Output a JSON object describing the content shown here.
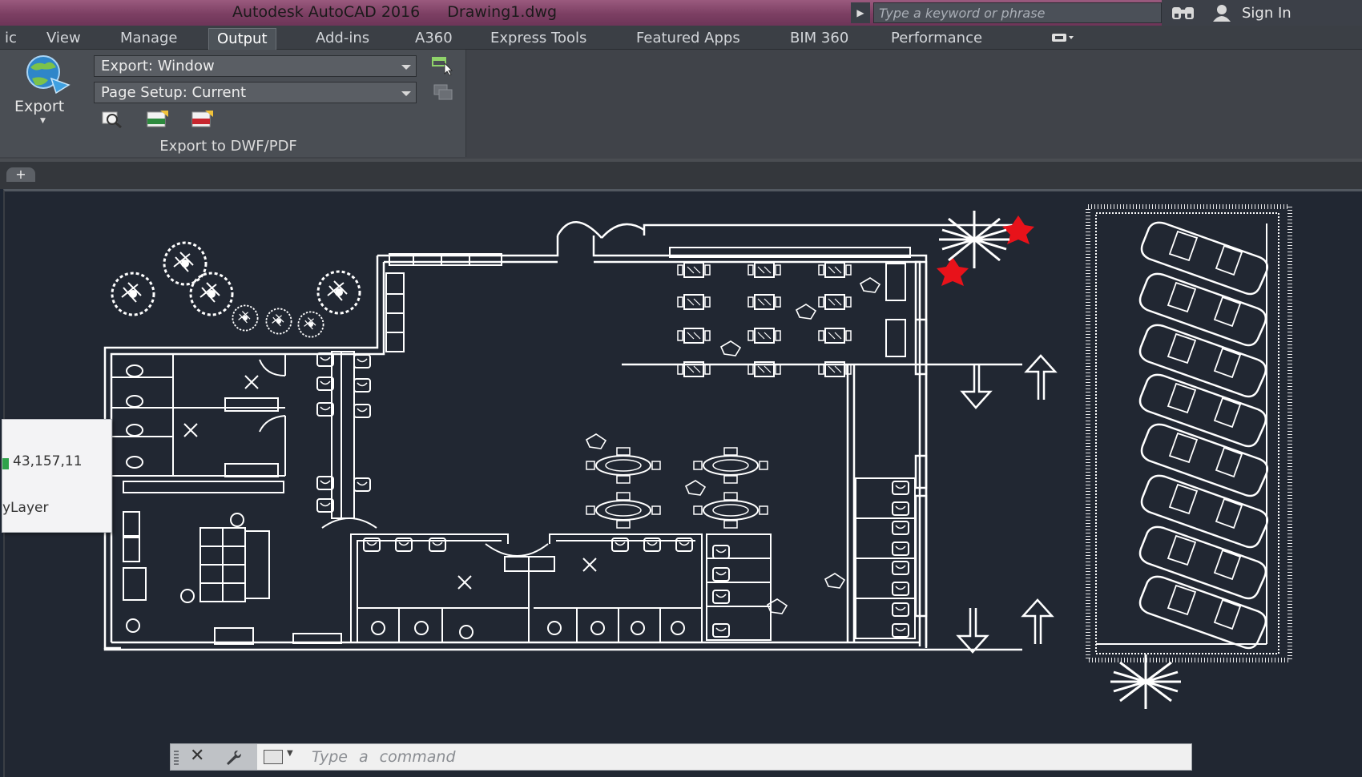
{
  "window": {
    "app_title": "Autodesk AutoCAD 2016",
    "file_name": "Drawing1.dwg"
  },
  "search": {
    "placeholder": "Type a keyword or phrase"
  },
  "account": {
    "sign_in_label": "Sign In"
  },
  "ribbon": {
    "tabs": [
      {
        "label": "ic"
      },
      {
        "label": "View"
      },
      {
        "label": "Manage"
      },
      {
        "label": "Output",
        "active": true
      },
      {
        "label": "Add-ins"
      },
      {
        "label": "A360"
      },
      {
        "label": "Express Tools"
      },
      {
        "label": "Featured Apps"
      },
      {
        "label": "BIM 360"
      },
      {
        "label": "Performance"
      }
    ],
    "export_button_label": "Export",
    "export_dropdown_value": "Export: Window",
    "page_setup_dropdown_value": "Page Setup: Current",
    "panel_label": "Export to DWF/PDF"
  },
  "file_tabs": {
    "new_tab_label": "+"
  },
  "properties_tooltip": {
    "color_value": "43,157,11",
    "layer_value": "yLayer",
    "color_swatch": "#2fa34b"
  },
  "command_line": {
    "placeholder": "Type a command"
  },
  "colors": {
    "title_bar": "#7c3f63",
    "canvas_background": "#212732",
    "drawing_lines": "#ffffff",
    "red_plants": "#e8121a"
  }
}
